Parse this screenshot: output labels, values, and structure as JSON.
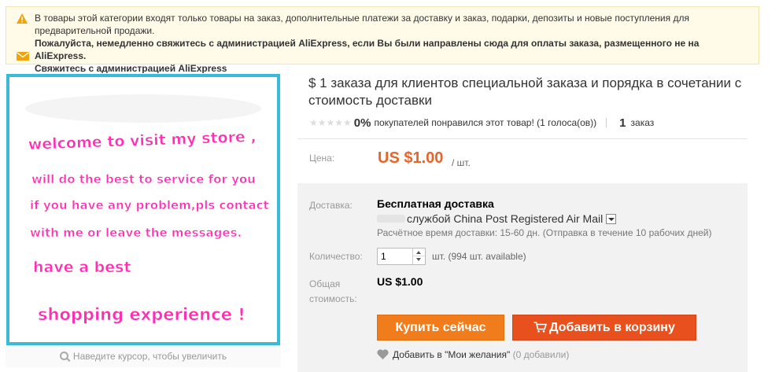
{
  "notice": {
    "line1": "В товары этой категории входят только товары на заказ, дополнительные платежи за доставку и заказ, подарки, депозиты и новые поступления для",
    "line2": "предварительной продажи.",
    "line3": "Пожалуйста, немедленно свяжитесь с администрацией AliExpress, если Вы были направлены сюда для оплаты заказа, размещенного не на AliExpress.",
    "contact_link": "Свяжитесь с администрацией AliExpress",
    "warning_icon": "warning-icon",
    "mail_icon": "mail-icon",
    "background": "#fffbe8"
  },
  "gallery": {
    "image_lines": [
      "welcome to visit my store ,",
      "will do the best to service for you",
      "if you have any problem,pls contact",
      "with me or leave the messages.",
      "have a best",
      "shopping experience !"
    ],
    "border_color": "#3cb9d6",
    "text_color": "#ff2fb4",
    "zoom_hint": "Наведите курсор, чтобы увеличить"
  },
  "product": {
    "title": "$ 1 заказа для клиентов специальной заказа и порядка в сочетании с стоимость доставки",
    "rating_percent": "0%",
    "rating_text": "покупателей понравился этот товар! (1 голоса(ов))",
    "orders_count": "1",
    "orders_label": "заказ",
    "stars": "★★★★★"
  },
  "price": {
    "label": "Цена:",
    "value": "US $1.00",
    "unit": "/ шт.",
    "color": "#e6652a"
  },
  "shipping": {
    "label": "Доставка:",
    "free": "Бесплатная доставка",
    "carrier": "службой China Post Registered Air Mail",
    "time": "Расчётное время доставки: 15-60 дн. (Отправка в течение 10 рабочих дней)"
  },
  "quantity": {
    "label": "Количество:",
    "value": "1",
    "available": "шт. (994 шт. available)"
  },
  "total": {
    "label_line1": "Общая",
    "label_line2": "стоимость:",
    "value": "US $1.00"
  },
  "actions": {
    "buy_now": "Купить сейчас",
    "add_to_cart": "Добавить в корзину",
    "buy_color": "#f07c1b",
    "cart_color": "#e8501e"
  },
  "wishlist": {
    "label": "Добавить в \"Мои желания\"",
    "count": "(0 добавили)"
  }
}
